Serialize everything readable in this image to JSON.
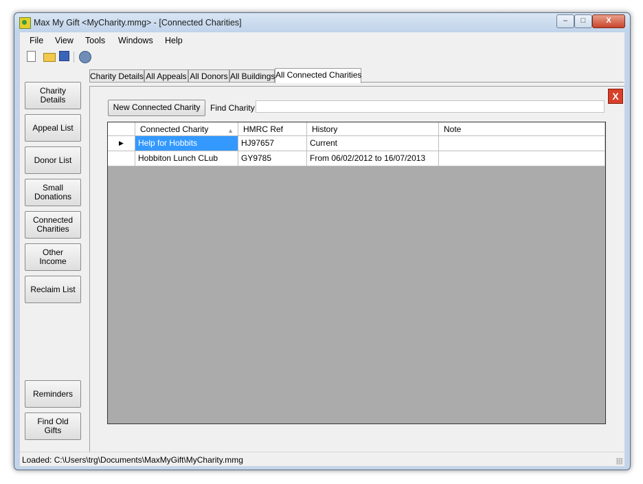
{
  "window": {
    "title": "Max My Gift <MyCharity.mmg>  - [Connected Charities]",
    "controls": {
      "minimize": "–",
      "maximize": "□",
      "close": "X"
    }
  },
  "menu": [
    {
      "label": "File"
    },
    {
      "label": "View"
    },
    {
      "label": "Tools"
    },
    {
      "label": "Windows"
    },
    {
      "label": "Help"
    }
  ],
  "toolbar": {
    "icons": [
      "new-document-icon",
      "open-folder-icon",
      "save-disk-icon",
      "help-icon"
    ]
  },
  "tabs": [
    {
      "label": "Charity Details",
      "active": false
    },
    {
      "label": "All Appeals",
      "active": false
    },
    {
      "label": "All Donors",
      "active": false
    },
    {
      "label": "All Buildings",
      "active": false
    },
    {
      "label": "All Connected Charities",
      "active": true
    }
  ],
  "sidebar": {
    "items": [
      {
        "label": "Charity Details"
      },
      {
        "label": "Appeal List"
      },
      {
        "label": "Donor List"
      },
      {
        "label": "Small Donations"
      },
      {
        "label": "Connected Charities"
      },
      {
        "label": "Other Income"
      },
      {
        "label": "Reclaim List"
      },
      {
        "label": "Reminders"
      },
      {
        "label": "Find Old Gifts"
      }
    ]
  },
  "panel": {
    "close_label": "X",
    "new_button": "New Connected Charity",
    "find_label": "Find Charity",
    "find_value": ""
  },
  "grid": {
    "columns": [
      "Connected Charity",
      "HMRC Ref",
      "History",
      "Note"
    ],
    "rows": [
      {
        "indicator": "▶",
        "charity": "Help for Hobbits",
        "hmrc_ref": "HJ97657",
        "history": "Current",
        "note": "",
        "selected": true
      },
      {
        "indicator": "",
        "charity": "Hobbiton Lunch CLub",
        "hmrc_ref": "GY9785",
        "history": "From 06/02/2012 to 16/07/2013",
        "note": "",
        "selected": false
      }
    ]
  },
  "status": {
    "text": "Loaded: C:\\Users\\trg\\Documents\\MaxMyGift\\MyCharity.mmg"
  }
}
